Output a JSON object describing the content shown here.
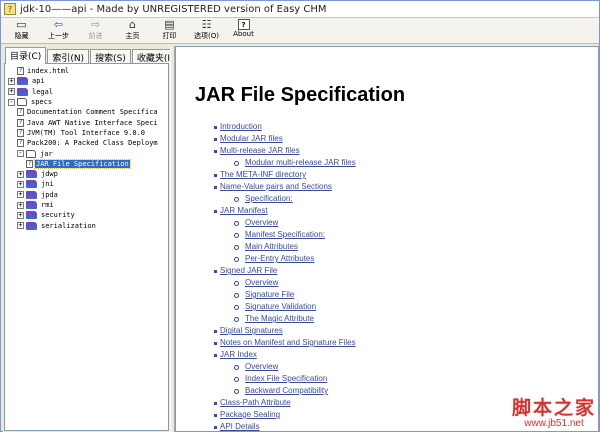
{
  "window": {
    "title": "jdk-10——api - Made by UNREGISTERED version of Easy CHM"
  },
  "toolbar": {
    "buttons": [
      {
        "label": "隐藏",
        "icon": "hide-icon",
        "enabled": true
      },
      {
        "label": "上一步",
        "icon": "back-arrow-icon",
        "enabled": true
      },
      {
        "label": "前进",
        "icon": "forward-arrow-icon",
        "enabled": false
      },
      {
        "label": "主页",
        "icon": "home-icon",
        "enabled": true
      },
      {
        "label": "打印",
        "icon": "print-icon",
        "enabled": true
      },
      {
        "label": "选项(O)",
        "icon": "options-icon",
        "enabled": true
      },
      {
        "label": "About",
        "icon": "about-icon",
        "enabled": true
      }
    ]
  },
  "nav_tabs": [
    {
      "label": "目录(C)",
      "active": true
    },
    {
      "label": "索引(N)",
      "active": false
    },
    {
      "label": "搜索(S)",
      "active": false
    },
    {
      "label": "收藏夹(I)",
      "active": false
    }
  ],
  "tree": [
    {
      "label": "index.html",
      "type": "page",
      "depth": 0,
      "expander": ""
    },
    {
      "label": "api",
      "type": "folder",
      "depth": 0,
      "expander": "+"
    },
    {
      "label": "legal",
      "type": "folder",
      "depth": 0,
      "expander": "+"
    },
    {
      "label": "specs",
      "type": "folder-open",
      "depth": 0,
      "expander": "-"
    },
    {
      "label": "Documentation Comment Specifica",
      "type": "page",
      "depth": 1,
      "expander": ""
    },
    {
      "label": "Java AWT Native Interface Speci",
      "type": "page",
      "depth": 1,
      "expander": ""
    },
    {
      "label": "JVM(TM) Tool Interface 9.0.0",
      "type": "page",
      "depth": 1,
      "expander": ""
    },
    {
      "label": "Pack200: A Packed Class Deploym",
      "type": "page",
      "depth": 1,
      "expander": ""
    },
    {
      "label": "jar",
      "type": "folder-open",
      "depth": 1,
      "expander": "-"
    },
    {
      "label": "JAR File Specification",
      "type": "page",
      "depth": 2,
      "expander": "",
      "selected": true
    },
    {
      "label": "jdwp",
      "type": "folder",
      "depth": 1,
      "expander": "+"
    },
    {
      "label": "jni",
      "type": "folder",
      "depth": 1,
      "expander": "+"
    },
    {
      "label": "jpda",
      "type": "folder",
      "depth": 1,
      "expander": "+"
    },
    {
      "label": "rmi",
      "type": "folder",
      "depth": 1,
      "expander": "+"
    },
    {
      "label": "security",
      "type": "folder",
      "depth": 1,
      "expander": "+"
    },
    {
      "label": "serialization",
      "type": "folder",
      "depth": 1,
      "expander": "+"
    }
  ],
  "content": {
    "heading": "JAR File Specification",
    "toc": [
      {
        "text": "Introduction",
        "level": 1
      },
      {
        "text": "Modular JAR files",
        "level": 1
      },
      {
        "text": "Multi-release JAR files",
        "level": 1
      },
      {
        "text": "Modular multi-release JAR files",
        "level": 2
      },
      {
        "text": "The META-INF directory",
        "level": 1
      },
      {
        "text": "Name-Value pairs and Sections",
        "level": 1
      },
      {
        "text": "Specification:",
        "level": 2
      },
      {
        "text": "JAR Manifest",
        "level": 1
      },
      {
        "text": "Overview",
        "level": 2
      },
      {
        "text": "Manifest Specification:",
        "level": 2
      },
      {
        "text": "Main Attributes",
        "level": 2
      },
      {
        "text": "Per-Entry Attributes",
        "level": 2
      },
      {
        "text": "Signed JAR File",
        "level": 1
      },
      {
        "text": "Overview",
        "level": 2
      },
      {
        "text": "Signature File",
        "level": 2
      },
      {
        "text": "Signature Validation",
        "level": 2
      },
      {
        "text": "The Magic Attribute",
        "level": 2
      },
      {
        "text": "Digital Signatures",
        "level": 1
      },
      {
        "text": "Notes on Manifest and Signature Files",
        "level": 1
      },
      {
        "text": "JAR Index",
        "level": 1
      },
      {
        "text": "Overview",
        "level": 2
      },
      {
        "text": "Index File Specification",
        "level": 2
      },
      {
        "text": "Backward Compatibility",
        "level": 2
      },
      {
        "text": "Class-Path Attribute",
        "level": 1
      },
      {
        "text": "Package Sealing",
        "level": 1
      },
      {
        "text": "API Details",
        "level": 1
      }
    ]
  },
  "watermark": {
    "text": "脚本之家",
    "url": "www.jb51.net",
    "color": "#d9302c"
  },
  "colors": {
    "selection": "#316ac5",
    "link": "#3a4a9a"
  }
}
